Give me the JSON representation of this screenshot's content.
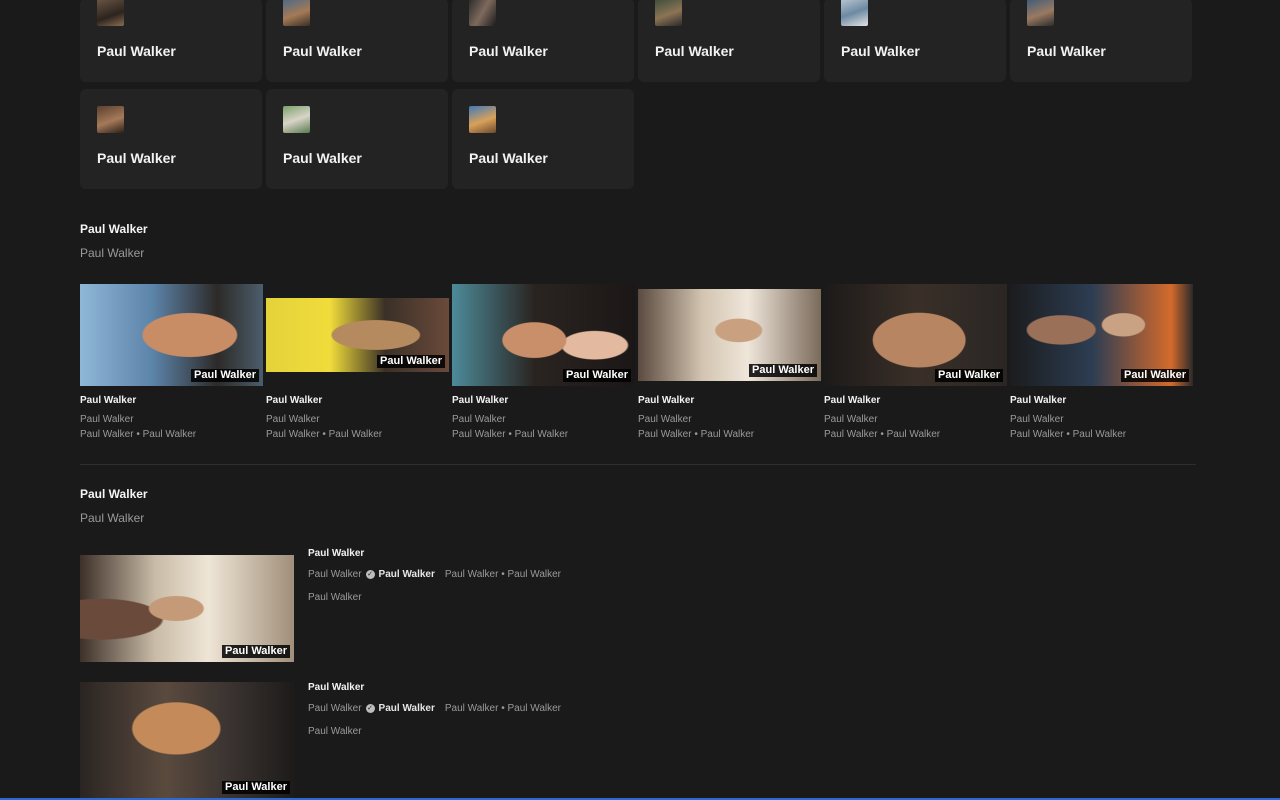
{
  "cards": [
    {
      "name": "Paul Walker",
      "icon": "person-avatar-icon"
    },
    {
      "name": "Paul Walker",
      "icon": "person-avatar-icon"
    },
    {
      "name": "Paul Walker",
      "icon": "person-avatar-icon"
    },
    {
      "name": "Paul Walker",
      "icon": "person-avatar-icon"
    },
    {
      "name": "Paul Walker",
      "icon": "person-avatar-icon"
    },
    {
      "name": "Paul Walker",
      "icon": "person-avatar-icon"
    },
    {
      "name": "Paul Walker",
      "icon": "person-avatar-icon"
    },
    {
      "name": "Paul Walker",
      "icon": "person-avatar-icon"
    },
    {
      "name": "Paul Walker",
      "icon": "person-avatar-icon"
    }
  ],
  "section1": {
    "title": "Paul Walker",
    "subtitle": "Paul Walker",
    "videos": [
      {
        "badge": "Paul Walker",
        "title": "Paul Walker",
        "line1": "Paul Walker",
        "line2": "Paul Walker • Paul Walker"
      },
      {
        "badge": "Paul Walker",
        "title": "Paul Walker",
        "line1": "Paul Walker",
        "line2": "Paul Walker • Paul Walker"
      },
      {
        "badge": "Paul Walker",
        "title": "Paul Walker",
        "line1": "Paul Walker",
        "line2": "Paul Walker • Paul Walker"
      },
      {
        "badge": "Paul Walker",
        "title": "Paul Walker",
        "line1": "Paul Walker",
        "line2": "Paul Walker • Paul Walker"
      },
      {
        "badge": "Paul Walker",
        "title": "Paul Walker",
        "line1": "Paul Walker",
        "line2": "Paul Walker • Paul Walker"
      },
      {
        "badge": "Paul Walker",
        "title": "Paul Walker",
        "line1": "Paul Walker",
        "line2": "Paul Walker • Paul Walker"
      }
    ]
  },
  "section2": {
    "title": "Paul Walker",
    "subtitle": "Paul Walker",
    "rows": [
      {
        "badge": "Paul Walker",
        "title": "Paul Walker",
        "meta_prefix": "Paul Walker",
        "channel": "Paul Walker",
        "meta_suffix": "Paul Walker • Paul Walker",
        "desc": "Paul Walker"
      },
      {
        "badge": "Paul Walker",
        "title": "Paul Walker",
        "meta_prefix": "Paul Walker",
        "channel": "Paul Walker",
        "meta_suffix": "Paul Walker • Paul Walker",
        "desc": "Paul Walker"
      }
    ]
  },
  "colors": {
    "background": "#1a1a1b",
    "card": "#232324",
    "accent": "#2a6ad6"
  }
}
